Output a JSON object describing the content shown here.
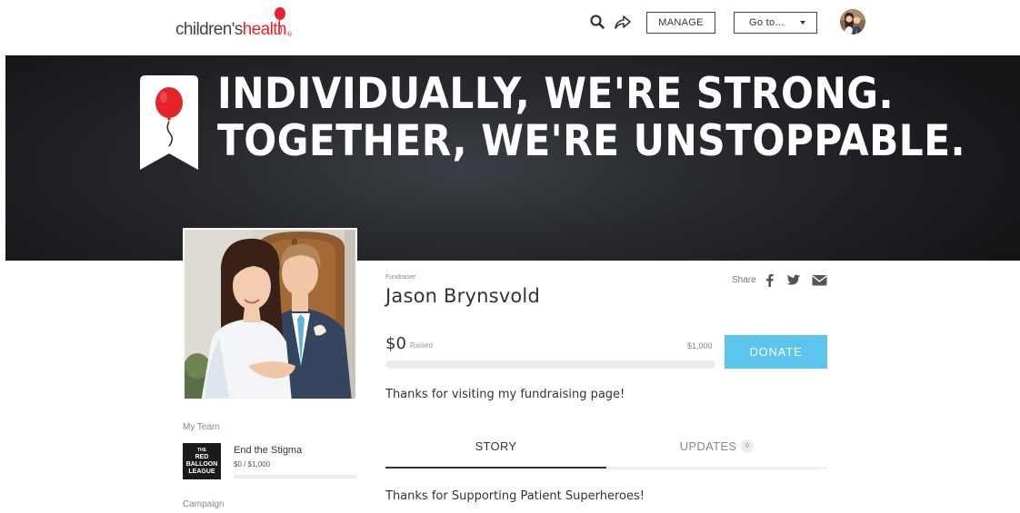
{
  "header": {
    "logo_part1": "children's",
    "logo_part2": "health",
    "manage_label": "MANAGE",
    "goto_label": "Go to...",
    "icons": [
      "search-icon",
      "share-arrow-icon",
      "chevron-down-icon",
      "user-avatar"
    ]
  },
  "hero": {
    "line1": "INDIVIDUALLY, WE'RE STRONG.",
    "line2": "TOGETHER, WE'RE UNSTOPPABLE."
  },
  "fundraiser": {
    "label": "Fundraiser",
    "name": "Jason Brynsvold",
    "share_label": "Share",
    "share_icons": [
      "facebook-icon",
      "twitter-icon",
      "email-icon"
    ],
    "raised_amount": "$0",
    "raised_label": "Raised",
    "goal": "$1,000",
    "progress_percent": 0,
    "donate_label": "DONATE",
    "thanks_message": "Thanks for visiting my fundraising page!"
  },
  "sidebar": {
    "my_team_label": "My Team",
    "team_logo_line1": "THE",
    "team_logo_line2": "RED BALLOON",
    "team_logo_line3": "LEAGUE",
    "team_name": "End the Stigma",
    "team_amount": "$0 / $1,000",
    "team_progress_percent": 0,
    "campaign_label": "Campaign"
  },
  "tabs": [
    {
      "label": "STORY",
      "active": true
    },
    {
      "label": "UPDATES",
      "count": "0",
      "active": false
    }
  ],
  "story": {
    "text": "Thanks for Supporting Patient Superheroes!"
  },
  "colors": {
    "accent": "#5cc5ee",
    "brand_red": "#e3242b",
    "hero_bg": "#1f2125"
  }
}
